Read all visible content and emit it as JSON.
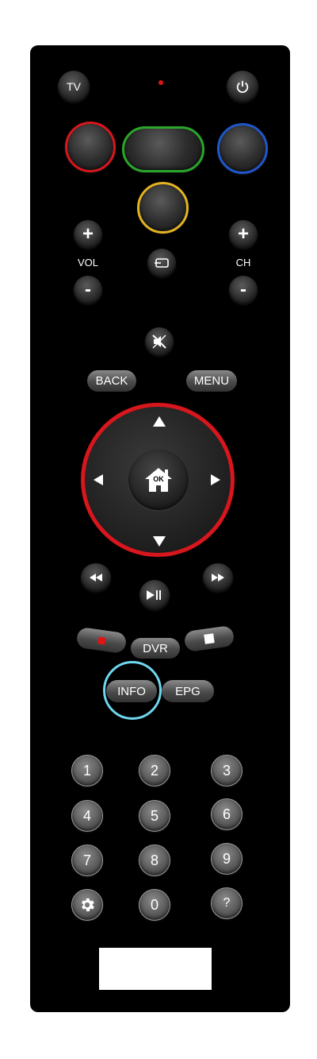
{
  "top": {
    "tv_label": "TV"
  },
  "volume": {
    "label": "VOL",
    "plus": "+",
    "minus": "-"
  },
  "channel": {
    "label": "CH",
    "plus": "+",
    "minus": "-"
  },
  "nav": {
    "back": "BACK",
    "menu": "MENU",
    "ok": "OK"
  },
  "media": {
    "dvr": "DVR",
    "info": "INFO",
    "epg": "EPG"
  },
  "keypad": [
    "1",
    "2",
    "3",
    "4",
    "5",
    "6",
    "7",
    "8",
    "9",
    "0",
    "?"
  ],
  "colors": {
    "red": "#d8161d",
    "green": "#2aa62a",
    "blue": "#1f56c9",
    "yellow": "#e3b321",
    "info_ring": "#6fd7ee",
    "led": "#e01414"
  }
}
